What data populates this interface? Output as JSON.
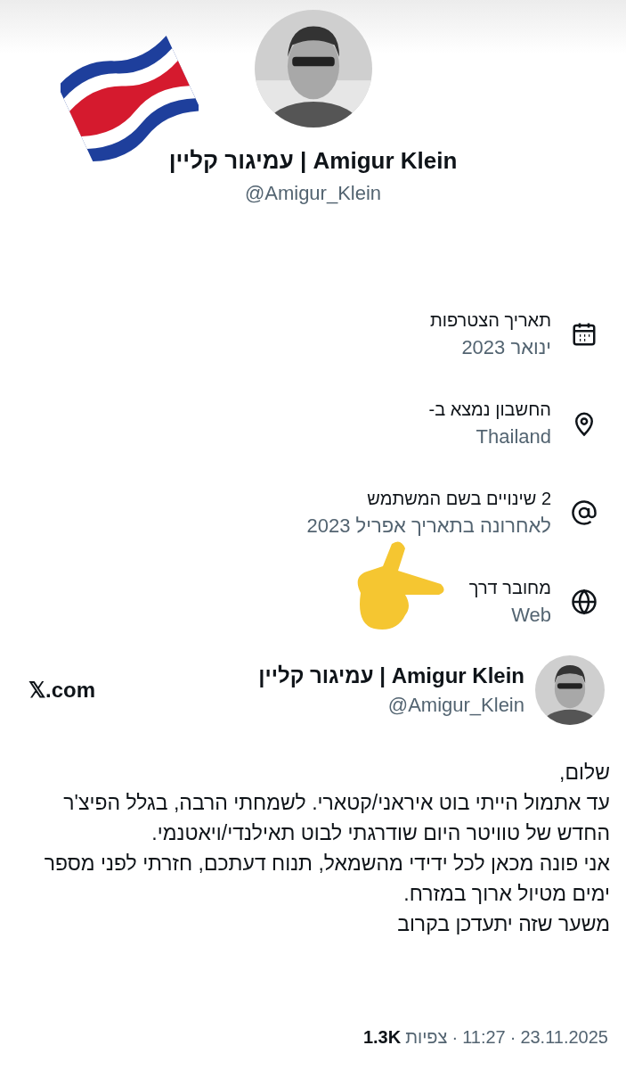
{
  "profile": {
    "name": "Amigur Klein | עמיגור קליין",
    "handle": "@Amigur_Klein"
  },
  "about": [
    {
      "kind": "calendar",
      "title": "תאריך הצטרפות",
      "value": "ינואר 2023"
    },
    {
      "kind": "location",
      "title": "החשבון נמצא ב-",
      "value": "Thailand"
    },
    {
      "kind": "at",
      "title": "2 שינויים בשם המשתמש",
      "value": "לאחרונה בתאריך אפריל 2023"
    },
    {
      "kind": "globe",
      "title": "מחובר דרך",
      "value": "Web"
    }
  ],
  "post": {
    "name": "Amigur Klein | עמיגור קליין",
    "handle": "@Amigur_Klein",
    "site": "𝕏.com",
    "paragraphs": [
      "שלום,",
      "עד אתמול הייתי בוט איראני/קטארי. לשמחתי הרבה, בגלל הפיצ'ר החדש של טוויטר היום שודרגתי לבוט תאילנדי/ויאטנמי.",
      "אני פונה מכאן לכל ידידי מהשמאל, תנוח דעתכם, חזרתי לפני מספר ימים מטיול ארוך במזרח.",
      "משער שזה יתעדכן בקרוב"
    ],
    "separator": "·",
    "date": "23.11.2025",
    "time": "11:27",
    "views_count": "1.3K",
    "views_label": "צפיות"
  }
}
